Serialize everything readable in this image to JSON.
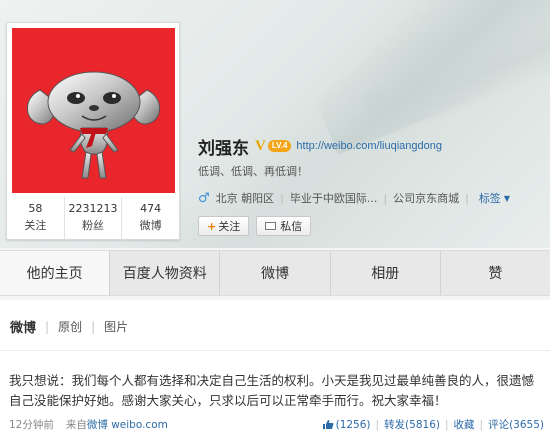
{
  "profile": {
    "name": "刘强东",
    "verify_badge": "V",
    "level_badge": "LV.4",
    "url": "http://weibo.com/liuqiangdong",
    "bio": "低调、低调、再低调！",
    "gender_icon": "♂",
    "location": "北京 朝阳区",
    "school": "毕业于中欧国际...",
    "company": "公司京东商城",
    "tags_label": "标签",
    "follow_button": "关注",
    "message_button": "私信",
    "avatar_icon": "jd-dog-mascot",
    "stats": [
      {
        "num": "58",
        "label": "关注"
      },
      {
        "num": "2231213",
        "label": "粉丝"
      },
      {
        "num": "474",
        "label": "微博"
      }
    ]
  },
  "tabs": [
    "他的主页",
    "百度人物资料",
    "微博",
    "相册",
    "赞"
  ],
  "feed": {
    "tabs": [
      "微博",
      "原创",
      "图片"
    ],
    "post": {
      "text": "我只想说：我们每个人都有选择和决定自己生活的权利。小天是我见过最单纯善良的人，很遗憾自己没能保护好她。感谢大家关心，只求以后可以正常牵手而行。祝大家幸福！",
      "time": "12分钟前",
      "source_prefix": "来自",
      "source": "微博 weibo.com",
      "likes": "(1256)",
      "repost": "转发(5816)",
      "favorite": "收藏",
      "comment": "评论(3655)"
    }
  },
  "colors": {
    "avatar_bg": "#e8262b",
    "link": "#2c6ba8",
    "verify": "#e7a700",
    "level_badge": "#f3a417"
  }
}
